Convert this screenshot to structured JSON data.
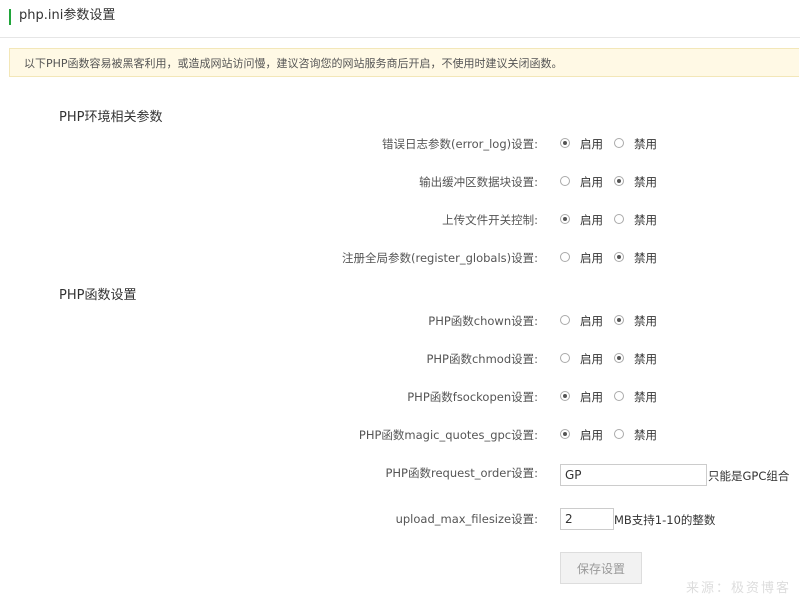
{
  "header": {
    "title": "php.ini参数设置"
  },
  "notice": {
    "text": "以下PHP函数容易被黑客利用，或造成网站访问慢，建议咨询您的网站服务商后开启，不使用时建议关闭函数。"
  },
  "sections": {
    "env": {
      "title": "PHP环境相关参数"
    },
    "func": {
      "title": "PHP函数设置"
    }
  },
  "options": {
    "enable": "启用",
    "disable": "禁用"
  },
  "settings": {
    "error_log": {
      "label": "错误日志参数(error_log)设置:",
      "value": "启用"
    },
    "output_buffering": {
      "label": "输出缓冲区数据块设置:",
      "value": "禁用"
    },
    "file_uploads": {
      "label": "上传文件开关控制:",
      "value": "启用"
    },
    "register_globals": {
      "label": "注册全局参数(register_globals)设置:",
      "value": "禁用"
    },
    "chown": {
      "label": "PHP函数chown设置:",
      "value": "禁用"
    },
    "chmod": {
      "label": "PHP函数chmod设置:",
      "value": "禁用"
    },
    "fsockopen": {
      "label": "PHP函数fsockopen设置:",
      "value": "启用"
    },
    "magic_quotes_gpc": {
      "label": "PHP函数magic_quotes_gpc设置:",
      "value": "启用"
    },
    "request_order": {
      "label": "PHP函数request_order设置:",
      "value": "GP",
      "hint": "只能是GPC组合"
    },
    "upload_max_filesize": {
      "label": "upload_max_filesize设置:",
      "value": "2",
      "hint": "MB支持1-10的整数"
    }
  },
  "actions": {
    "save_label": "保存设置"
  },
  "watermark": {
    "text": "来源：极资博客"
  }
}
